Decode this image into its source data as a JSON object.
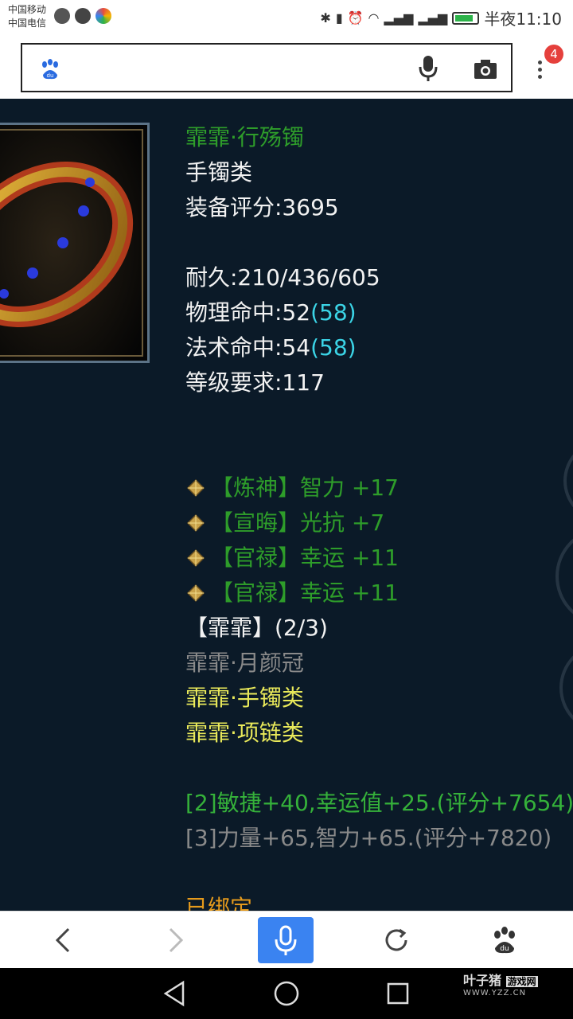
{
  "status_bar": {
    "carrier_1": "中国移动",
    "carrier_2": "中国电信",
    "time": "半夜11:10"
  },
  "browser": {
    "tab_count": "4",
    "search_placeholder": ""
  },
  "item": {
    "name": "霏霏·行殇镯",
    "category": "手镯类",
    "score_label": "装备评分:3695",
    "durability": "耐久:210/436/605",
    "phys_hit_label": "物理命中:52",
    "phys_hit_bonus": "(58)",
    "magic_hit_label": "法术命中:54",
    "magic_hit_bonus": "(58)",
    "level_req": "等级要求:117",
    "enchants": [
      "【炼神】智力 +17",
      "【宣晦】光抗 +7",
      "【官禄】幸运 +11",
      "【官禄】幸运 +11"
    ],
    "set_title": "【霏霏】(2/3)",
    "set_pieces": [
      "霏霏·月颜冠",
      "霏霏·手镯类",
      "霏霏·项链类"
    ],
    "set_bonus_2": "[2]敏捷+40,幸运值+25.(评分+7654)",
    "set_bonus_3": "[3]力量+65,智力+65.(评分+7820)",
    "bound": "已绑定"
  },
  "watermark": {
    "brand": "叶子猪",
    "tag": "游戏网",
    "url": "WWW.YZZ.CN"
  },
  "colors": {
    "background": "#0b1a28",
    "item_name": "#2e9d2a",
    "bonus_cyan": "#3bd4e6",
    "set_active": "#e9e95a",
    "browser_blue": "#3a83f1"
  }
}
